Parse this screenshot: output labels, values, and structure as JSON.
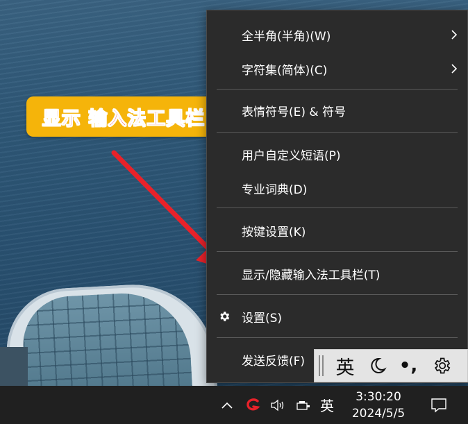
{
  "annotation": {
    "text": "显示 输入法工具栏"
  },
  "menu": {
    "items": [
      {
        "label": "全半角(半角)(W)",
        "submenu": true
      },
      {
        "label": "字符集(简体)(C)",
        "submenu": true
      },
      {
        "label": "表情符号(E) & 符号"
      },
      {
        "label": "用户自定义短语(P)"
      },
      {
        "label": "专业词典(D)"
      },
      {
        "label": "按键设置(K)"
      },
      {
        "label": "显示/隐藏输入法工具栏(T)"
      },
      {
        "label": "设置(S)",
        "icon": "gear-icon"
      },
      {
        "label": "发送反馈(F)"
      }
    ]
  },
  "ime_toolbar": {
    "language": "英",
    "mode_icon": "moon-icon",
    "punctuation": "•,",
    "settings_icon": "gear-icon"
  },
  "taskbar": {
    "tray_chevron": "^",
    "ime_logo_icon": "sogou-ime-icon",
    "volume_icon": "speaker-icon",
    "network_icon": "network-icon",
    "language": "英",
    "time": "3:30:20",
    "date": "2024/5/5",
    "notification_icon": "notification-icon"
  },
  "colors": {
    "menu_bg": "#2b2b2b",
    "annotation_bg": "#f5b40a",
    "annotation_text": "#e8222a",
    "arrow": "#e8222a",
    "taskbar_bg": "#202020"
  }
}
